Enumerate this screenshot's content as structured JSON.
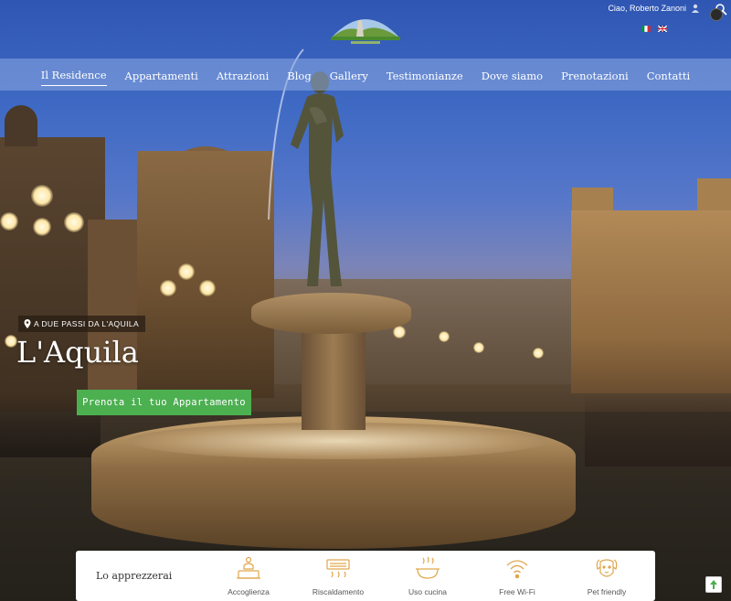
{
  "header": {
    "greeting": "Ciao, Roberto Zanoni",
    "logo_text": "",
    "languages": [
      {
        "code": "it",
        "icon": "italian-flag-icon"
      },
      {
        "code": "en",
        "icon": "uk-flag-icon"
      }
    ]
  },
  "nav": {
    "items": [
      {
        "label": "Il Residence",
        "active": true
      },
      {
        "label": "Appartamenti"
      },
      {
        "label": "Attrazioni"
      },
      {
        "label": "Blog"
      },
      {
        "label": "Gallery"
      },
      {
        "label": "Testimonianze"
      },
      {
        "label": "Dove siamo"
      },
      {
        "label": "Prenotazioni"
      },
      {
        "label": "Contatti"
      }
    ]
  },
  "hero": {
    "tag": "A DUE PASSI DA L'AQUILA",
    "title": "L'Aquila",
    "cta": "Prenota il tuo Appartamento"
  },
  "features": {
    "heading": "Lo apprezzerai",
    "items": [
      {
        "label": "Accoglienza",
        "icon": "reception-bell-icon"
      },
      {
        "label": "Riscaldamento",
        "icon": "heating-icon"
      },
      {
        "label": "Uso cucina",
        "icon": "cooking-pot-icon"
      },
      {
        "label": "Free Wi-Fi",
        "icon": "wifi-icon"
      },
      {
        "label": "Pet friendly",
        "icon": "dog-icon"
      }
    ]
  },
  "colors": {
    "accent": "#4caf50",
    "icon_gold": "#e0a64c",
    "nav_bg": "#8caae1"
  }
}
